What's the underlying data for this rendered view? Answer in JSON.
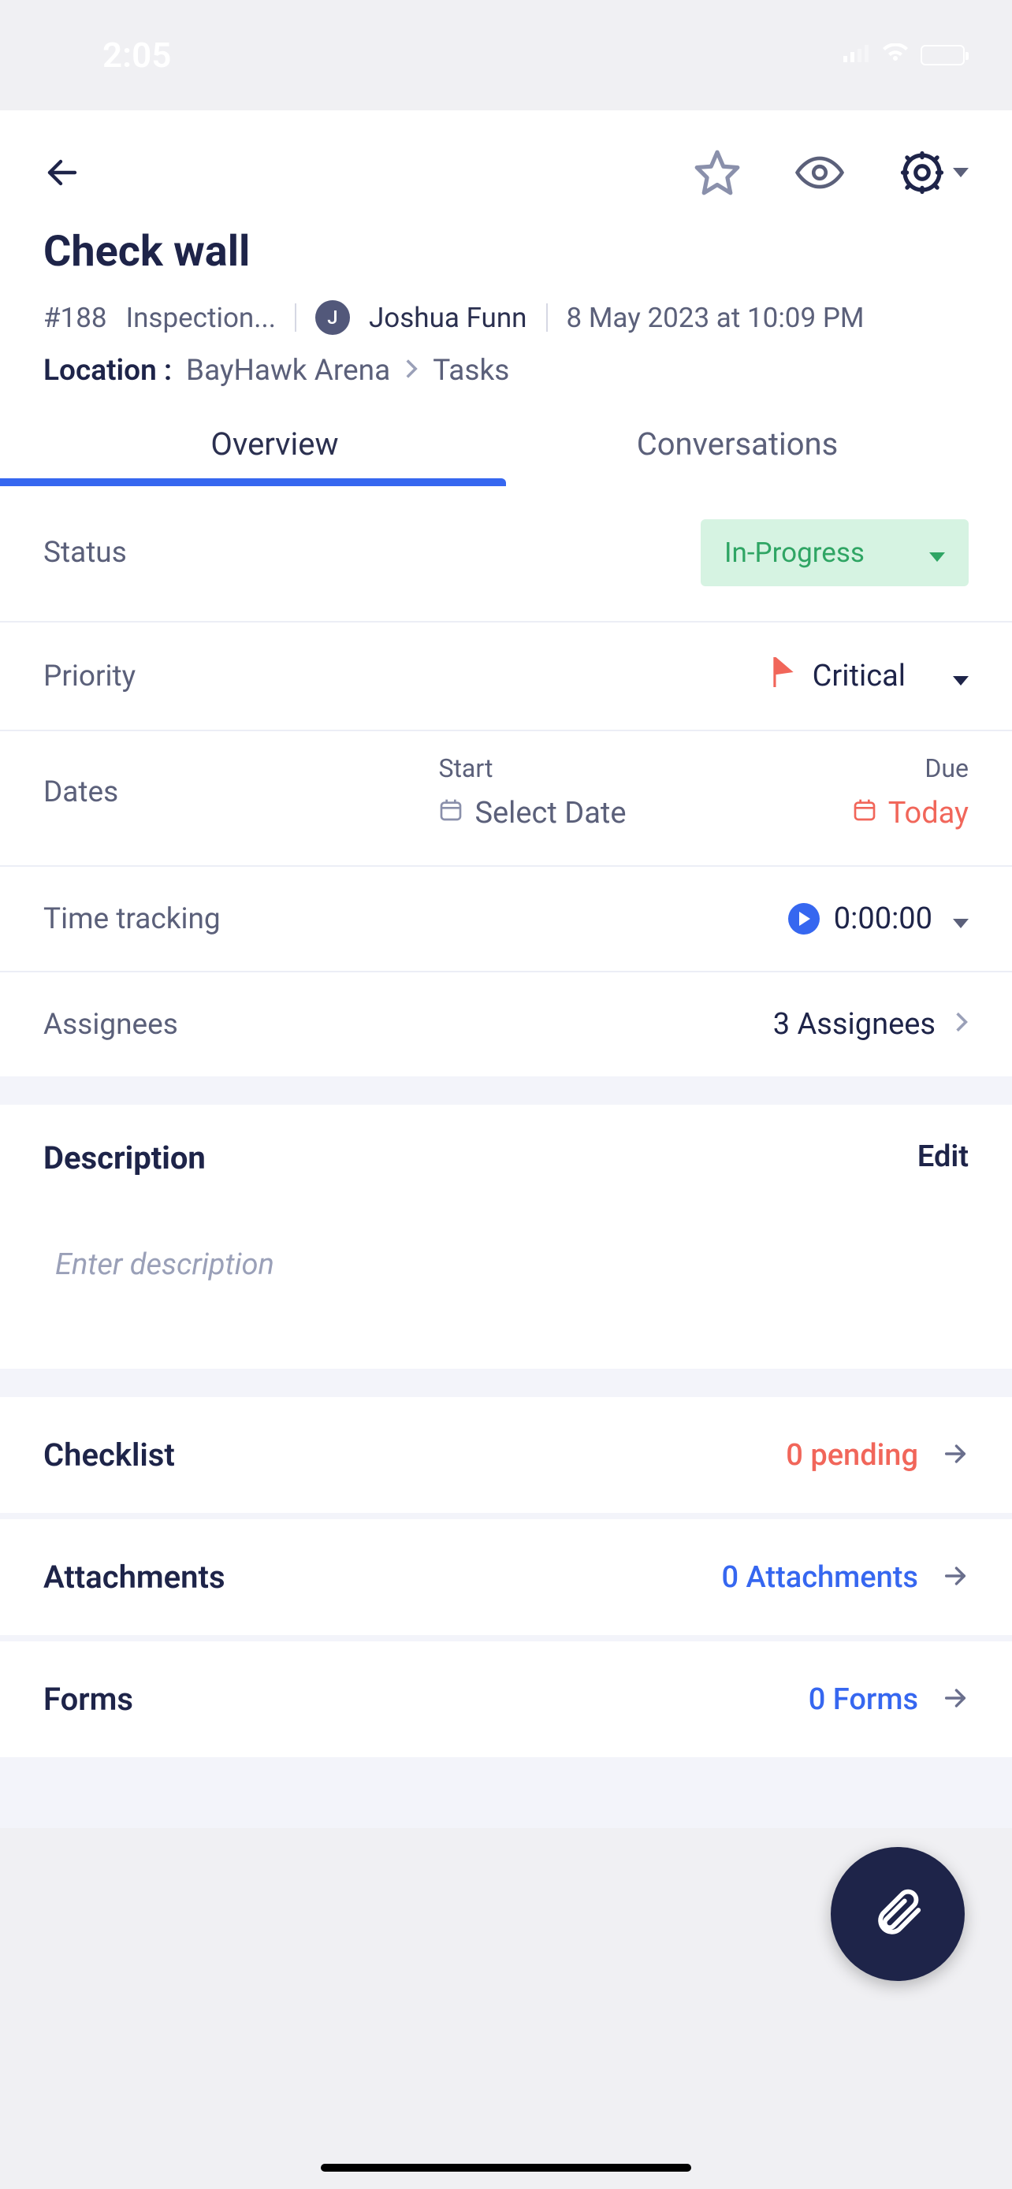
{
  "status_bar": {
    "time": "2:05"
  },
  "task": {
    "title": "Check wall",
    "id": "#188",
    "type": "Inspection...",
    "author_initial": "J",
    "author_name": "Joshua Funn",
    "timestamp": "8 May 2023 at 10:09 PM",
    "location_label": "Location :",
    "location_primary": "BayHawk Arena",
    "location_secondary": "Tasks"
  },
  "tabs": {
    "overview": "Overview",
    "conversations": "Conversations"
  },
  "fields": {
    "status_label": "Status",
    "status_value": "In-Progress",
    "priority_label": "Priority",
    "priority_value": "Critical",
    "dates_label": "Dates",
    "start_label": "Start",
    "start_value": "Select Date",
    "due_label": "Due",
    "due_value": "Today",
    "time_label": "Time tracking",
    "time_value": "0:00:00",
    "assignees_label": "Assignees",
    "assignees_value": "3 Assignees"
  },
  "description": {
    "title": "Description",
    "edit": "Edit",
    "placeholder": "Enter description"
  },
  "nav": {
    "checklist_label": "Checklist",
    "checklist_value": "0 pending",
    "attachments_label": "Attachments",
    "attachments_value": "0 Attachments",
    "forms_label": "Forms",
    "forms_value": "0 Forms"
  }
}
